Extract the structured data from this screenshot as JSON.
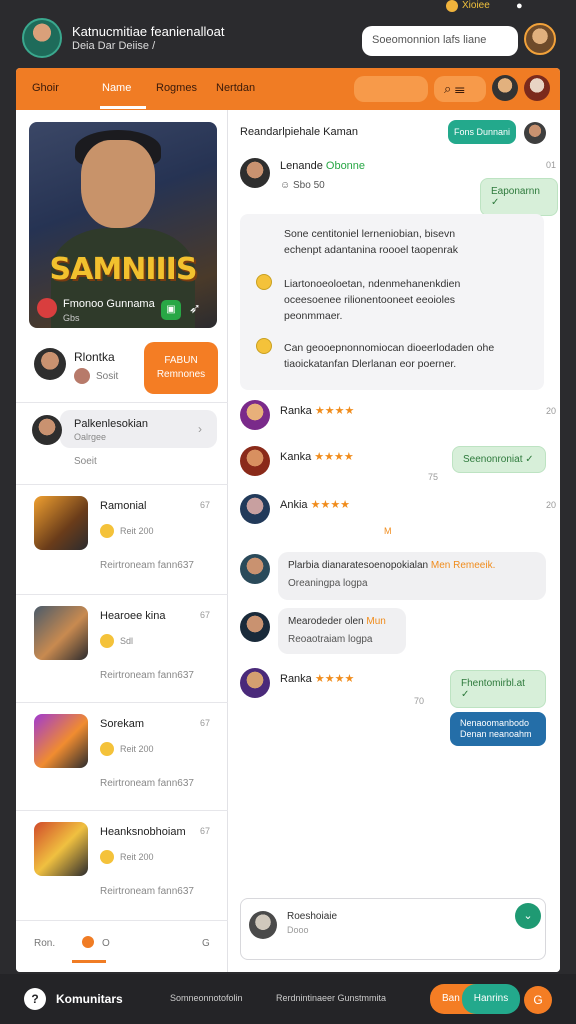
{
  "status": {
    "text": "Xioiee"
  },
  "header": {
    "title": "Katnucmitiae feanienalloat",
    "subtitle": "Deia Dar Deiise /",
    "search_placeholder": "Soeomonnion lafs liane"
  },
  "tabs": [
    {
      "label": "Ghoir"
    },
    {
      "label": "Name"
    },
    {
      "label": "Rogmes"
    },
    {
      "label": "Nertdan"
    }
  ],
  "sidebar": {
    "hero": {
      "title": "SAMNIIIS",
      "name": "Fmonoo Gunnama",
      "sub": "Gbs"
    },
    "friend": {
      "name": "Rlontka",
      "sub": "Sosit"
    },
    "join_button": "FABUN\nRemnones",
    "selected": {
      "name": "Palkenlesokian",
      "sub": "Oalrgee",
      "meta": "Soeit"
    },
    "games": [
      {
        "name": "Ramonial",
        "num": "67",
        "sub": "Reit 200",
        "foot": "Reirtroneam fann637"
      },
      {
        "name": "Hearoee kina",
        "num": "67",
        "sub": "Sdl",
        "foot": "Reirtroneam fann637"
      },
      {
        "name": "Sorekam",
        "num": "67",
        "sub": "Reit 200",
        "foot": "Reirtroneam fann637"
      },
      {
        "name": "Heanksnobhoiam",
        "num": "67",
        "sub": "Reit 200",
        "foot": "Reirtroneam fann637"
      }
    ],
    "bottom": {
      "left": "Ron.",
      "center": "O",
      "right": "G"
    }
  },
  "chat": {
    "title": "Reandarlpiehale Kaman",
    "button": "Fons Dunnani",
    "first": {
      "name": "Lenande",
      "tag": "Obonne",
      "time": "01",
      "sub": "Sbo 50"
    },
    "first_reply": "Eaponarnn ✓",
    "block_lines": [
      "Sone centitoniel lerneniobian, bisevn",
      "echenpt adantanina roooel taopenrak",
      "Liartonoeoloetan, ndenmehanenkdien",
      "oceesoenee rilionentooneet eeoioles",
      "peonmmaer.",
      "Can geooepnonnomiocan dioeerlodaden ohe",
      "tiaoickatanfan Dlerlanan eor poerner."
    ],
    "messages": [
      {
        "name": "Ranka",
        "stars": "★★★★",
        "time": "20"
      },
      {
        "name": "Kanka",
        "stars": "★★★★",
        "time": "75",
        "reply": "Seenonroniat ✓"
      },
      {
        "name": "Ankia",
        "stars": "★★★★",
        "time": "20"
      },
      {
        "name": "Plarbia dianaratesoenopokialan",
        "tag": "Men Remeeik.",
        "sub": "Oreaningpa logpa"
      },
      {
        "name": "Mearodeder olen",
        "tag": "Mun",
        "sub": "Reoaotraiam logpa"
      },
      {
        "name": "Ranka",
        "stars": "★★★★",
        "time": "70",
        "reply": "Fhentomirbl.at ✓"
      }
    ],
    "mid_marker": "M",
    "blue_bubble": "Nenaoomanbodo\nDenan neanoahm",
    "compose": {
      "name": "Roeshoiaie",
      "placeholder": "Dooo"
    }
  },
  "footer": {
    "brand": "Komunitars",
    "links": [
      "Somneonnotofolin",
      "Rerdnintinaeer Gunstmmita"
    ],
    "btn1": "Ban",
    "btn2": "Hanrins",
    "btn3": "G"
  }
}
